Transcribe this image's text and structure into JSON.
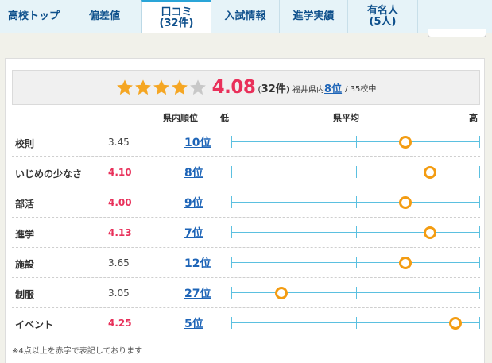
{
  "tabs": [
    {
      "label": "高校トップ",
      "active": false
    },
    {
      "label": "偏差値",
      "active": false
    },
    {
      "label": "口コミ",
      "sub": "(32件)",
      "active": true
    },
    {
      "label": "入試情報",
      "active": false
    },
    {
      "label": "進学実績",
      "active": false
    },
    {
      "label": "有名人",
      "sub": "(5人)",
      "active": false
    }
  ],
  "rating": {
    "stars_filled": 4,
    "stars_total": 5,
    "score": "4.08",
    "count_open": "(",
    "count": "32件",
    "count_close": ")",
    "pref_label": "福井県内",
    "pref_rank": "8位",
    "total": "/ 35校中"
  },
  "headers": {
    "rank": "県内順位",
    "low": "低",
    "avg": "県平均",
    "high": "高"
  },
  "rows": [
    {
      "label": "校則",
      "value": "3.45",
      "highlight": false,
      "rank": "10位",
      "level": 0.7
    },
    {
      "label": "いじめの少なさ",
      "value": "4.10",
      "highlight": true,
      "rank": "8位",
      "level": 0.8
    },
    {
      "label": "部活",
      "value": "4.00",
      "highlight": true,
      "rank": "9位",
      "level": 0.7
    },
    {
      "label": "進学",
      "value": "4.13",
      "highlight": true,
      "rank": "7位",
      "level": 0.8
    },
    {
      "label": "施設",
      "value": "3.65",
      "highlight": false,
      "rank": "12位",
      "level": 0.7
    },
    {
      "label": "制服",
      "value": "3.05",
      "highlight": false,
      "rank": "27位",
      "level": 0.2
    },
    {
      "label": "イベント",
      "value": "4.25",
      "highlight": true,
      "rank": "5位",
      "level": 0.9
    }
  ],
  "note": "※4点以上を赤字で表記しております",
  "colors": {
    "accent": "#2aa5d8",
    "red": "#e8305a",
    "link": "#1d64b7",
    "star": "#f5a623",
    "dot": "#f39c12",
    "scale": "#5bc0e0"
  }
}
